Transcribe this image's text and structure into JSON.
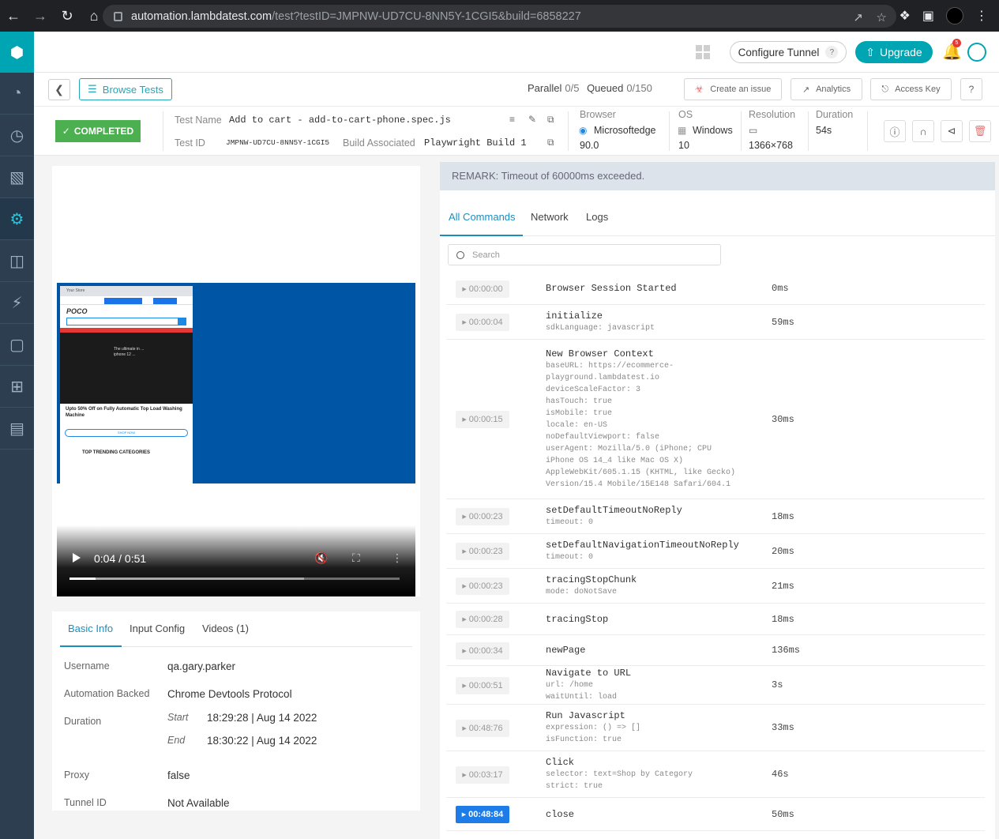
{
  "browser": {
    "url_host": "automation.lambdatest.com",
    "url_path": "/test?testID=JMPNW-UD7CU-8NN5Y-1CGI5&build=6858227"
  },
  "header": {
    "configure_tunnel": "Configure Tunnel",
    "help_q": "?",
    "upgrade": "Upgrade",
    "notification_count": "5"
  },
  "subbar": {
    "browse_tests": "Browse Tests",
    "parallel_label": "Parallel",
    "parallel_value": "0/5",
    "queued_label": "Queued",
    "queued_value": "0/150",
    "create_issue": "Create an issue",
    "analytics": "Analytics",
    "access_key": "Access Key",
    "help": "?"
  },
  "test": {
    "status": "COMPLETED",
    "name_label": "Test Name",
    "name": "Add to cart - add-to-cart-phone.spec.js",
    "id_label": "Test ID",
    "id": "JMPNW-UD7CU-8NN5Y-1CGI5",
    "build_label": "Build Associated",
    "build": "Playwright Build 1",
    "browser_label": "Browser",
    "browser_name": "Microsoftedge",
    "browser_version": "90.0",
    "os_label": "OS",
    "os_name": "Windows",
    "os_version": "10",
    "resolution_label": "Resolution",
    "resolution": "1366×768",
    "duration_label": "Duration",
    "duration": "54s"
  },
  "video": {
    "time": "0:04 / 0:51",
    "progress_fraction": 0.078,
    "buffered_fraction": 0.71,
    "phone": {
      "logo": "POCO",
      "tab_title": "Your Store",
      "hero_text": "The ultimate in ... iphone 12 ...",
      "headline": "Upto 50% Off on Fully Automatic Top Load Washing Machine",
      "shop_now": "SHOP NOW",
      "trending": "TOP TRENDING CATEGORIES"
    }
  },
  "info_tabs": {
    "basic": "Basic Info",
    "input_config": "Input Config",
    "videos": "Videos (1)"
  },
  "basic_info": {
    "username_label": "Username",
    "username": "qa.gary.parker",
    "automation_label": "Automation Backed",
    "automation": "Chrome Devtools Protocol",
    "duration_label": "Duration",
    "start_label": "Start",
    "start": "18:29:28 | Aug 14 2022",
    "end_label": "End",
    "end": "18:30:22 | Aug 14 2022",
    "proxy_label": "Proxy",
    "proxy": "false",
    "tunnel_label": "Tunnel ID",
    "tunnel": "Not Available"
  },
  "remark": "REMARK: Timeout of 60000ms exceeded.",
  "command_tabs": {
    "all": "All Commands",
    "network": "Network",
    "logs": "Logs"
  },
  "search": {
    "placeholder": "Search"
  },
  "commands": [
    {
      "ts": "00:00:00",
      "name": "Browser Session Started",
      "params": "",
      "dur": "0ms"
    },
    {
      "ts": "00:00:04",
      "name": "initialize",
      "params": "sdkLanguage: javascript",
      "dur": "59ms"
    },
    {
      "ts": "00:00:15",
      "name": "New Browser Context",
      "params": "baseURL: https://ecommerce-\nplayground.lambdatest.io\ndeviceScaleFactor: 3\nhasTouch: true\nisMobile: true\nlocale: en-US\nnoDefaultViewport: false\nuserAgent: Mozilla/5.0 (iPhone; CPU\niPhone OS 14_4 like Mac OS X)\nAppleWebKit/605.1.15 (KHTML, like Gecko)\nVersion/15.4 Mobile/15E148 Safari/604.1",
      "dur": "30ms"
    },
    {
      "ts": "00:00:23",
      "name": "setDefaultTimeoutNoReply",
      "params": "timeout: 0",
      "dur": "18ms"
    },
    {
      "ts": "00:00:23",
      "name": "setDefaultNavigationTimeoutNoReply",
      "params": "timeout: 0",
      "dur": "20ms"
    },
    {
      "ts": "00:00:23",
      "name": "tracingStopChunk",
      "params": "mode: doNotSave",
      "dur": "21ms"
    },
    {
      "ts": "00:00:28",
      "name": "tracingStop",
      "params": "",
      "dur": "18ms"
    },
    {
      "ts": "00:00:34",
      "name": "newPage",
      "params": "",
      "dur": "136ms"
    },
    {
      "ts": "00:00:51",
      "name": "Navigate to URL",
      "params": "url: /home\nwaitUntil: load",
      "dur": "3s"
    },
    {
      "ts": "00:48:76",
      "name": "Run Javascript",
      "params": "expression: () => []\nisFunction: true",
      "dur": "33ms"
    },
    {
      "ts": "00:03:17",
      "name": "Click",
      "params": "selector: text=Shop by Category\nstrict: true",
      "dur": "46s"
    },
    {
      "ts": "00:48:84",
      "name": "close",
      "params": "",
      "dur": "50ms"
    }
  ]
}
